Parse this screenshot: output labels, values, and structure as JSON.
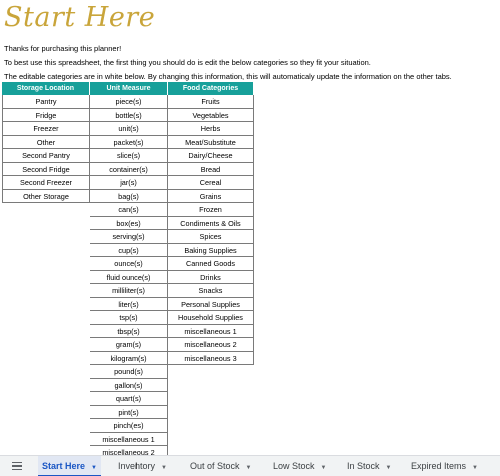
{
  "title": "Start Here",
  "intro": {
    "line1": "Thanks for purchasing this planner!",
    "line2": "To best use this spreadsheet, the first thing you should do is edit the below categories so they fit your situation.",
    "line3": "The editable categories are in white below. By changing this information, this will automaticaly update the information on the other tabs."
  },
  "table": {
    "headers": [
      "Storage Location",
      "Unit Measure",
      "Food Categories"
    ],
    "storage_locations": [
      "Pantry",
      "Fridge",
      "Freezer",
      "Other",
      "Second Pantry",
      "Second Fridge",
      "Second Freezer",
      "Other Storage"
    ],
    "unit_measures": [
      "piece(s)",
      "bottle(s)",
      "unit(s)",
      "packet(s)",
      "slice(s)",
      "container(s)",
      "jar(s)",
      "bag(s)",
      "can(s)",
      "box(es)",
      "serving(s)",
      "cup(s)",
      "ounce(s)",
      "fluid ounce(s)",
      "milliliter(s)",
      "liter(s)",
      "tsp(s)",
      "tbsp(s)",
      "gram(s)",
      "kilogram(s)",
      "pound(s)",
      "gallon(s)",
      "quart(s)",
      "pint(s)",
      "pinch(es)",
      "miscellaneous 1",
      "miscellaneous 2"
    ],
    "food_categories": [
      "Fruits",
      "Vegetables",
      "Herbs",
      "Meat/Substitute",
      "Dairy/Cheese",
      "Bread",
      "Cereal",
      "Grains",
      "Frozen",
      "Condiments & Oils",
      "Spices",
      "Baking Supplies",
      "Canned Goods",
      "Drinks",
      "Snacks",
      "Personal Supplies",
      "Household Supplies",
      "miscellaneous 1",
      "miscellaneous 2",
      "miscellaneous 3"
    ]
  },
  "sheet_tabs": [
    {
      "label": "Start Here",
      "active": true
    },
    {
      "label": "Inventory",
      "active": false
    },
    {
      "label": "Out of Stock",
      "active": false
    },
    {
      "label": "Low Stock",
      "active": false
    },
    {
      "label": "In Stock",
      "active": false
    },
    {
      "label": "Expired Items",
      "active": false
    }
  ],
  "colors": {
    "header_bg": "#17a09a",
    "title": "#c9a53a",
    "active_tab": "#1a56c4"
  },
  "icons": {
    "menu": "all-sheets-menu-icon",
    "tab_arrow": "caret-down-icon"
  }
}
